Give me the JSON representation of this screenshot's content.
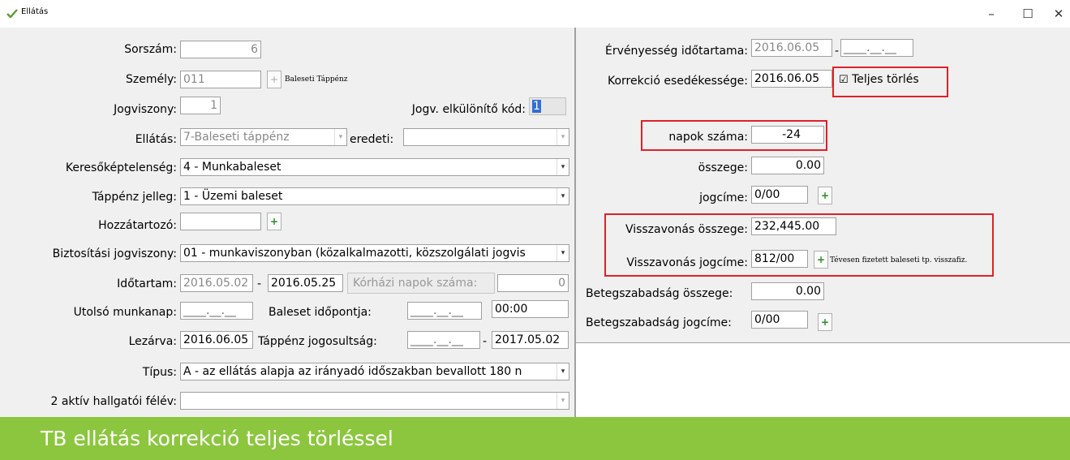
{
  "window": {
    "title": "Ellátás",
    "minimize": "–",
    "maximize": "☐",
    "close": "✕"
  },
  "left": {
    "sorszam_label": "Sorszám:",
    "sorszam_value": "6",
    "szemely_label": "Személy:",
    "szemely_value": "011",
    "szemely_desc": "Baleseti Táppénz",
    "jogviszony_label": "Jogviszony:",
    "jogviszony_value": "1",
    "jogv_kod_label": "Jogv. elkülönítő kód:",
    "jogv_kod_value": "1",
    "ellatas_label": "Ellátás:",
    "ellatas_value": "7-Baleseti táppénz",
    "eredeti_label": "eredeti:",
    "eredeti_value": "",
    "kereso_label": "Keresőképtelenség:",
    "kereso_value": "4 - Munkabaleset",
    "tappenz_jelleg_label": "Táppénz jelleg:",
    "tappenz_jelleg_value": "1 - Üzemi baleset",
    "hozzatartozo_label": "Hozzátartozó:",
    "hozzatartozo_value": "",
    "biztositasi_label": "Biztosítási jogviszony:",
    "biztositasi_value": "01 - munkaviszonyban (közalkalmazotti, közszolgálati jogvis",
    "idotartam_label": "Időtartam:",
    "idotartam_from": "2016.05.02",
    "idotartam_sep": "-",
    "idotartam_to": "2016.05.25",
    "korhazi_label": "Kórházi napok száma:",
    "korhazi_value": "0",
    "utolso_label": "Utolsó munkanap:",
    "utolso_value": "____.__.__",
    "baleset_label": "Baleset időpontja:",
    "baleset_date": "____.__.__",
    "baleset_time": "00:00",
    "lezarva_label": "Lezárva:",
    "lezarva_value": "2016.06.05",
    "jogosultsag_label": "Táppénz jogosultság:",
    "jogosultsag_from": "____.__.__",
    "jogosultsag_sep": "-",
    "jogosultsag_to": "2017.05.02",
    "tipus_label": "Típus:",
    "tipus_value": "A - az ellátás alapja az irányadó időszakban bevallott 180 n",
    "aktiv_label": "2 aktív hallgatói félév:",
    "aktiv_value": ""
  },
  "right": {
    "ervenyesseg_label": "Érvényesség időtartama:",
    "ervenyesseg_from": "2016.06.05",
    "ervenyesseg_sep": "-",
    "ervenyesseg_to": "____.__.__",
    "korrekcio_label": "Korrekció esedékessége:",
    "korrekcio_value": "2016.06.05",
    "teljes_torles_check": "☑",
    "teljes_torles_label": "Teljes törlés",
    "napok_label": "napok száma:",
    "napok_value": "-24",
    "osszege_label": "összege:",
    "osszege_value": "0.00",
    "jogcime_label": "jogcíme:",
    "jogcime_value": "0/00",
    "visszavonas_osszege_label": "Visszavonás összege:",
    "visszavonas_osszege_value": "232,445.00",
    "visszavonas_jogcime_label": "Visszavonás jogcíme:",
    "visszavonas_jogcime_value": "812/00",
    "visszavonas_jogcime_desc": "Tévesen fizetett baleseti tp. visszafiz.",
    "betegszab_osszege_label": "Betegszabadság összege:",
    "betegszab_osszege_value": "0.00",
    "betegszab_jogcime_label": "Betegszabadság jogcíme:",
    "betegszab_jogcime_value": "0/00"
  },
  "icons": {
    "plus": "+",
    "dropdown": "▾"
  },
  "caption": "TB ellátás korrekció teljes törléssel",
  "colors": {
    "caption_bg": "#8cc63e",
    "highlight_red": "#e0202a"
  }
}
